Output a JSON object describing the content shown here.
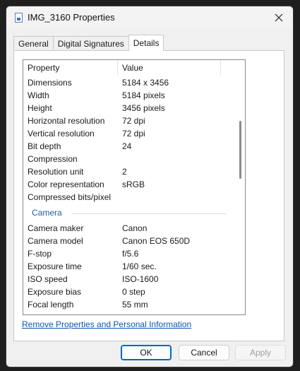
{
  "window": {
    "title": "IMG_3160 Properties"
  },
  "tabs": [
    {
      "label": "General",
      "active": false
    },
    {
      "label": "Digital Signatures",
      "active": false
    },
    {
      "label": "Details",
      "active": true
    }
  ],
  "list": {
    "headers": {
      "property": "Property",
      "value": "Value"
    },
    "image_rows": [
      {
        "property": "Dimensions",
        "value": "5184 x 3456"
      },
      {
        "property": "Width",
        "value": "5184 pixels"
      },
      {
        "property": "Height",
        "value": "3456 pixels"
      },
      {
        "property": "Horizontal resolution",
        "value": "72 dpi"
      },
      {
        "property": "Vertical resolution",
        "value": "72 dpi"
      },
      {
        "property": "Bit depth",
        "value": "24"
      },
      {
        "property": "Compression",
        "value": ""
      },
      {
        "property": "Resolution unit",
        "value": "2"
      },
      {
        "property": "Color representation",
        "value": "sRGB"
      },
      {
        "property": "Compressed bits/pixel",
        "value": ""
      }
    ],
    "camera_group": "Camera",
    "camera_rows": [
      {
        "property": "Camera maker",
        "value": "Canon"
      },
      {
        "property": "Camera model",
        "value": "Canon EOS 650D"
      },
      {
        "property": "F-stop",
        "value": "f/5.6"
      },
      {
        "property": "Exposure time",
        "value": "1/60 sec."
      },
      {
        "property": "ISO speed",
        "value": "ISO-1600"
      },
      {
        "property": "Exposure bias",
        "value": "0 step"
      },
      {
        "property": "Focal length",
        "value": "55 mm"
      }
    ]
  },
  "remove_link": "Remove Properties and Personal Information",
  "buttons": {
    "ok": "OK",
    "cancel": "Cancel",
    "apply": "Apply"
  },
  "icons": {
    "title": "image-file-icon",
    "close": "close-icon"
  }
}
